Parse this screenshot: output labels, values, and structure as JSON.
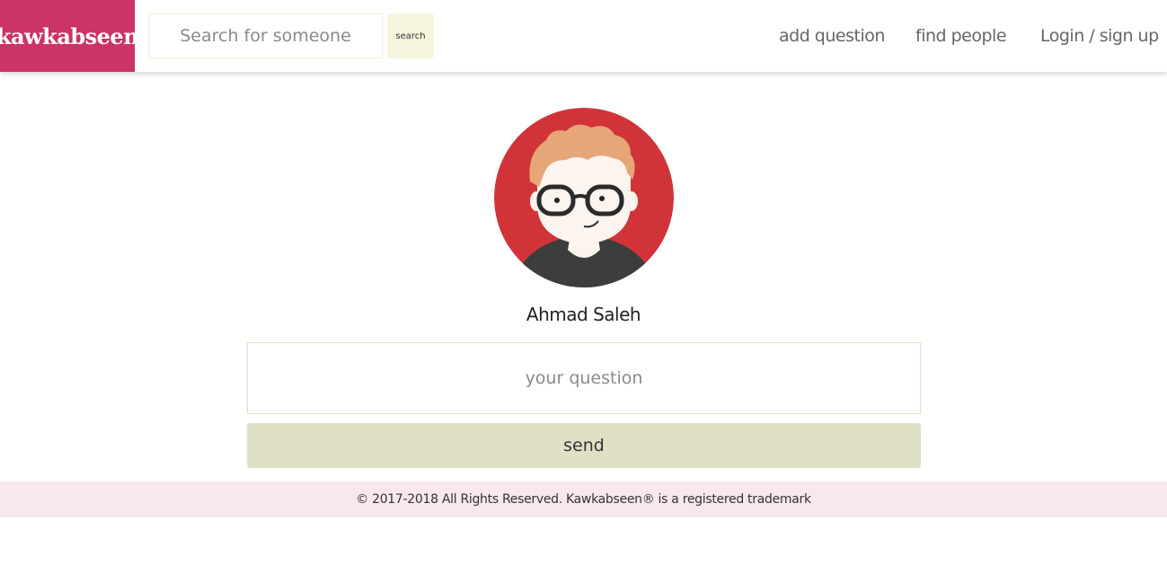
{
  "brand": {
    "name": "kawkabseen",
    "color": "#cc3366"
  },
  "search": {
    "placeholder": "Search for someone",
    "button_label": "search"
  },
  "nav": {
    "add_question": "add question",
    "find_people": "find people",
    "login": "Login / sign up"
  },
  "profile": {
    "name": "Ahmad Saleh",
    "avatar_icon": "cartoon-avatar-glasses"
  },
  "question": {
    "placeholder": "your question",
    "send_label": "send"
  },
  "footer": {
    "text": "© 2017-2018 All Rights Reserved. Kawkabseen® is a registered trademark"
  },
  "colors": {
    "avatar_bg": "#d13438",
    "send_button": "#e0e0c5",
    "search_button": "#f5f5dc",
    "footer_bg": "#f8e8ee"
  }
}
